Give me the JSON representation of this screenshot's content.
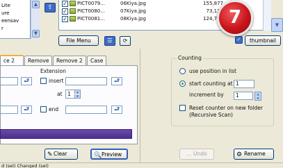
{
  "left_list": {
    "items": [
      "Lite",
      "ure",
      "eensav",
      "r"
    ]
  },
  "files": [
    {
      "name": "PICT0079...",
      "desc": "06Kiya.jpg",
      "size": "155,877",
      "type": "JPG"
    },
    {
      "name": "PICT0080...",
      "desc": "07Kiya.jpg",
      "size": "73,134",
      "type": "JPG"
    },
    {
      "name": "PICT0081...",
      "desc": "08Kiya.jpg",
      "size": "124,778",
      "type": "JPG"
    }
  ],
  "badge": {
    "number": "7",
    "color": "#c8151c"
  },
  "toolbar": {
    "file_menu_label": "File Menu",
    "thumbnail_label": "thumbnail"
  },
  "tabs": [
    {
      "label": "ce 2",
      "active": true
    },
    {
      "label": "Remove",
      "active": false
    },
    {
      "label": "Remove 2",
      "active": false
    },
    {
      "label": "Case",
      "active": false
    }
  ],
  "tab_panel": {
    "extension_label": "Extension",
    "insert_label": "insert",
    "at_label": "at",
    "at_value": "1",
    "end_label": "end"
  },
  "buttons": {
    "clear_label": "Clear",
    "preview_label": "Preview",
    "undo_label": "... Undo",
    "rename_label": "Rename"
  },
  "counting": {
    "title": "Counting",
    "option1_label": "use position in list",
    "option2_label": "start counting at",
    "start_value": "1",
    "increment_label": "increment by",
    "increment_value": "1",
    "reset_label_line1": "Reset counter on new folder",
    "reset_label_line2": "(Recursive Scan)"
  },
  "status": {
    "text": "d (sel) Changed (sel)"
  }
}
